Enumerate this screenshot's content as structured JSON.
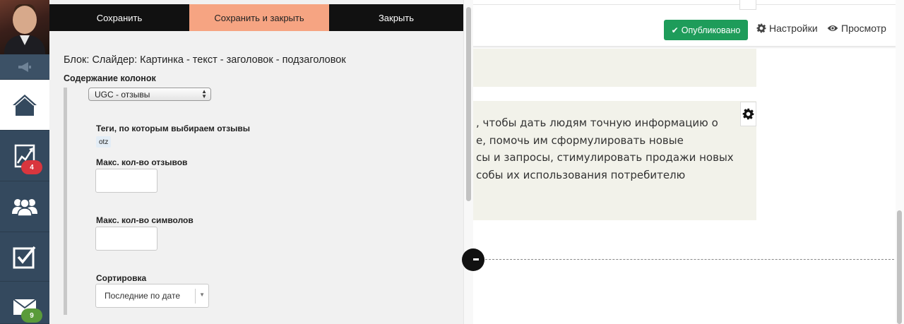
{
  "toolbar": {
    "save": "Сохранить",
    "save_close": "Сохранить и закрыть",
    "close": "Закрыть",
    "colors": {
      "dark": "#111111",
      "accent": "#f6a482"
    }
  },
  "sidebar": {
    "items": [
      {
        "icon": "speaker-icon"
      },
      {
        "icon": "home-icon",
        "active": true
      },
      {
        "icon": "stats-icon",
        "badge": "4"
      },
      {
        "icon": "users-icon"
      },
      {
        "icon": "checkbox-icon"
      },
      {
        "icon": "mail-icon",
        "badge": "9"
      }
    ]
  },
  "editor": {
    "block_title": "Блок: Слайдер: Картинка - текст - заголовок - подзаголовок",
    "columns_label": "Содержание колонок",
    "columns_value": "UGC - отзывы",
    "tags_label": "Теги, по которым выбираем отзывы",
    "tag_value": "otz",
    "max_reviews_label": "Макс. кол-во отзывов",
    "max_reviews_value": "",
    "max_chars_label": "Макс. кол-во символов",
    "max_chars_value": "",
    "sort_label": "Сортировка",
    "sort_value": "Последние по дате"
  },
  "header": {
    "published": "Опубликовано",
    "settings": "Настройки",
    "preview": "Просмотр",
    "published_color": "#1e9c5a"
  },
  "content": {
    "lines": [
      ", чтобы дать людям точную информацию о",
      "е, помочь им сформулировать новые",
      "сы и запросы, стимулировать продажи новых",
      "собы их использования потребителю"
    ],
    "bg_color": "#f2f2ea"
  }
}
